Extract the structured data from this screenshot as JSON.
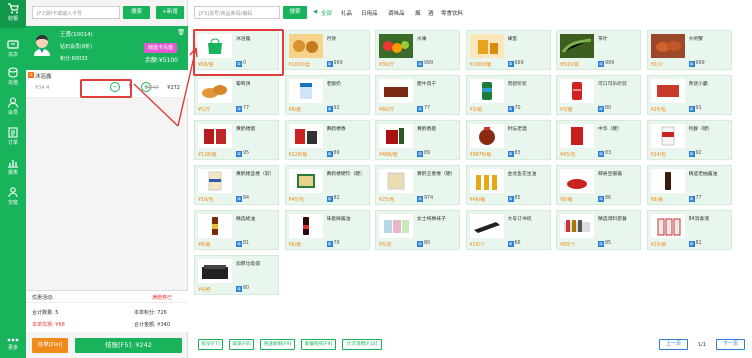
{
  "sidebar": {
    "items": [
      {
        "label": "收银",
        "icon": "cart-icon"
      },
      {
        "label": "充次",
        "icon": "ticket-icon"
      },
      {
        "label": "充值",
        "icon": "coin-icon"
      },
      {
        "label": "会员",
        "icon": "user-icon"
      },
      {
        "label": "订单",
        "icon": "order-icon"
      },
      {
        "label": "报表",
        "icon": "chart-icon"
      },
      {
        "label": "交班",
        "icon": "handover-icon"
      }
    ],
    "more_label": "更多"
  },
  "left": {
    "search_placeholder": "[F2]刷卡或输入卡号",
    "search_label": "搜索",
    "new_label": "+新增"
  },
  "member": {
    "name": "王勇(10014)",
    "level": "钻石会员(8折)",
    "points": "积分:60033",
    "balance": "余额:¥5100",
    "recharge_label": "储值卡充值"
  },
  "cart": {
    "items": [
      {
        "tag": "次",
        "name": "沐浴露",
        "price": "¥34.4",
        "qty": "5",
        "old_total": "¥340",
        "total": "¥272"
      }
    ]
  },
  "promo": {
    "label": "优惠活动:",
    "value": "满赠券已"
  },
  "summary": {
    "qty": "合计数量: 5",
    "points": "本单积分: 726",
    "discount": "本单优惠: ¥68",
    "amount": "合计金额: ¥340"
  },
  "actions": {
    "pending": "挂单[Del]",
    "checkout": "结账[F5]: ¥242"
  },
  "top": {
    "search_placeholder": "[F3]货号/商品条码/编码",
    "search_label": "搜索",
    "categories": [
      "◀",
      "全部",
      "礼品",
      "日用品",
      "调味品",
      "烟",
      "酒",
      "零食饮料"
    ]
  },
  "products": [
    {
      "name": "沐浴露",
      "price": "¥68/瓶",
      "stock": "0",
      "img": "bag"
    },
    {
      "name": "月饼",
      "price": "¥1000/盒",
      "stock": "999",
      "img": "mooncake"
    },
    {
      "name": "水果",
      "price": "¥30/斤",
      "stock": "999",
      "img": "fruit"
    },
    {
      "name": "蜂蜜",
      "price": "¥1000/罐",
      "stock": "999",
      "img": "honey"
    },
    {
      "name": "茶叶",
      "price": "¥500/袋",
      "stock": "999",
      "img": "tea"
    },
    {
      "name": "大闸蟹",
      "price": "¥0/只",
      "stock": "999",
      "img": "crab"
    },
    {
      "name": "葡萄饼",
      "price": "¥5/斤",
      "stock": "77",
      "img": "bread"
    },
    {
      "name": "老酸奶",
      "price": "¥8/瓶",
      "stock": "92",
      "img": "yogurt"
    },
    {
      "name": "腊牛肉干",
      "price": "¥80/斤",
      "stock": "77",
      "img": "beef"
    },
    {
      "name": "雪碧听装",
      "price": "¥3/瓶",
      "stock": "70",
      "img": "sprite"
    },
    {
      "name": "可口可乐听装",
      "price": "¥3/瓶",
      "stock": "80",
      "img": "cola"
    },
    {
      "name": "青烧小霸",
      "price": "¥25/包",
      "stock": "91",
      "img": "fish"
    },
    {
      "name": "黄鹤楼烟",
      "price": "¥128/瓶",
      "stock": "95",
      "img": "wine1"
    },
    {
      "name": "黄鹤楼香",
      "price": "¥128/瓶",
      "stock": "89",
      "img": "wine2"
    },
    {
      "name": "黄鹤香鹿",
      "price": "¥468/瓶",
      "stock": "89",
      "img": "wine3"
    },
    {
      "name": "封坛老酒",
      "price": "¥9876/瓶",
      "stock": "83",
      "img": "jar"
    },
    {
      "name": "中华（硬）",
      "price": "¥45/包",
      "stock": "83",
      "img": "cig1"
    },
    {
      "name": "利群（硬）",
      "price": "¥14/包",
      "stock": "92",
      "img": "cig2"
    },
    {
      "name": "黄鹤楼蓝楼（软）",
      "price": "¥19/包",
      "stock": "84",
      "img": "cig3"
    },
    {
      "name": "黄鹤楼硬珍（硬）",
      "price": "¥45/包",
      "stock": "82",
      "img": "cig4"
    },
    {
      "name": "黄鹤王者楼（硬）",
      "price": "¥25/包",
      "stock": "974",
      "img": "cig5"
    },
    {
      "name": "金龙鱼花生油",
      "price": "¥46/桶",
      "stock": "85",
      "img": "oil"
    },
    {
      "name": "郫县豆瓣酱",
      "price": "¥8/瓶",
      "stock": "86",
      "img": "sauce"
    },
    {
      "name": "精选老抽酱油",
      "price": "¥8/瓶",
      "stock": "77",
      "img": "soy"
    },
    {
      "name": "精选蚝油",
      "price": "¥8/瓶",
      "stock": "81",
      "img": "oyster"
    },
    {
      "name": "味极鲜酱油",
      "price": "¥6/瓶",
      "stock": "79",
      "img": "soy2"
    },
    {
      "name": "女士纯棉袜子",
      "price": "¥5/双",
      "stock": "80",
      "img": "socks"
    },
    {
      "name": "大号订书机",
      "price": "¥15/个",
      "stock": "66",
      "img": "stapler"
    },
    {
      "name": "精选调料套餐",
      "price": "¥68/个",
      "stock": "85",
      "img": "spice"
    },
    {
      "name": "84消毒液",
      "price": "¥15/瓶",
      "stock": "82",
      "img": "bleach"
    },
    {
      "name": "加厚垃圾袋",
      "price": "¥4/把",
      "stock": "80",
      "img": "trashbag"
    }
  ],
  "footer": {
    "buttons": [
      "指令[F7]",
      "取单[F8]",
      "快速收银[F9]",
      "套餐购买[F9]",
      "计次消费[F10]"
    ],
    "prev": "上一页",
    "next": "下一页",
    "page": "1/1"
  },
  "colors": {
    "brand": "#19b35c",
    "accent": "#f08a1a",
    "highlight": "#e03c3c",
    "info": "#2a7fd6"
  }
}
